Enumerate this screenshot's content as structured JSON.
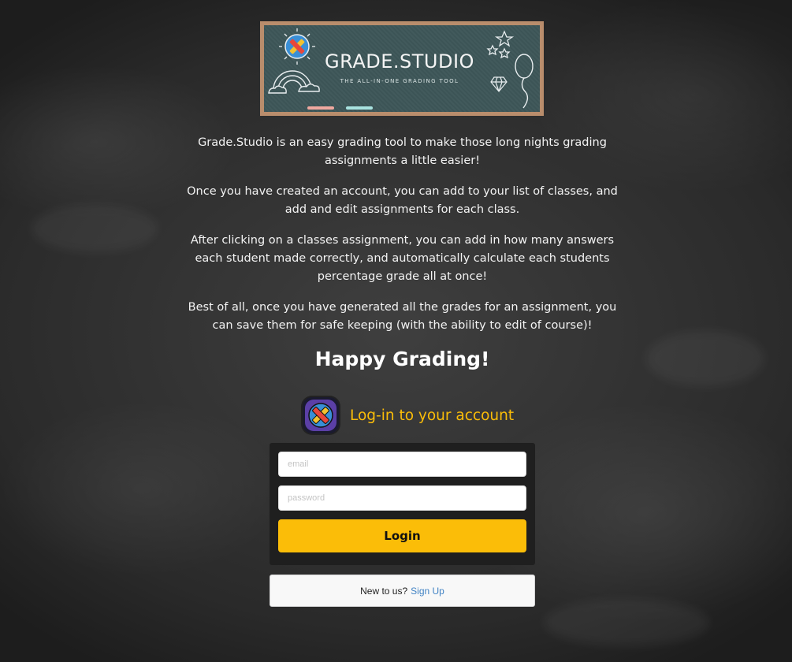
{
  "banner": {
    "title": "GRADE.STUDIO",
    "subtitle": "THE ALL-IN-ONE GRADING TOOL",
    "chalk_colors": [
      "#f0a9a0",
      "#a9e3e0"
    ]
  },
  "intro": {
    "paragraphs": [
      "Grade.Studio is an easy grading tool to make those long nights grading assignments a little easier!",
      "Once you have created an account, you can add to your list of classes, and add and edit assignments for each class.",
      "After clicking on a classes assignment, you can add in how many answers each student made correctly, and automatically calculate each students percentage grade all at once!",
      "Best of all, once you have generated all the grades for an assignment, you can save them for safe keeping (with the ability to edit of course)!"
    ],
    "closing": "Happy Grading!"
  },
  "login": {
    "title": "Log-in to your account",
    "icon": "pencil-ruler-icon",
    "email_placeholder": "email",
    "password_placeholder": "password",
    "button_label": "Login",
    "accent_color": "#fbbd08"
  },
  "signup": {
    "prompt": "New to us?",
    "link_label": "Sign Up",
    "link_color": "#4183c4"
  }
}
